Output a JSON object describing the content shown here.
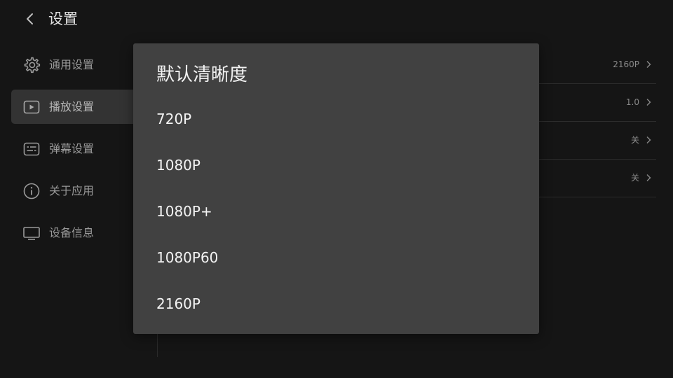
{
  "header": {
    "title": "设置"
  },
  "sidebar": {
    "items": [
      {
        "label": "通用设置",
        "icon": "gear-icon",
        "active": false
      },
      {
        "label": "播放设置",
        "icon": "play-icon",
        "active": true
      },
      {
        "label": "弹幕设置",
        "icon": "danmaku-icon",
        "active": false
      },
      {
        "label": "关于应用",
        "icon": "info-icon",
        "active": false
      },
      {
        "label": "设备信息",
        "icon": "tv-icon",
        "active": false
      }
    ]
  },
  "settings": {
    "rows": [
      {
        "value": "2160P"
      },
      {
        "value": "1.0"
      },
      {
        "value": "关"
      },
      {
        "value": "关"
      }
    ]
  },
  "dialog": {
    "title": "默认清晰度",
    "options": [
      "720P",
      "1080P",
      "1080P+",
      "1080P60",
      "2160P"
    ]
  },
  "colors": {
    "background": "#151515",
    "dialog": "#414141",
    "active_item": "#333333"
  }
}
